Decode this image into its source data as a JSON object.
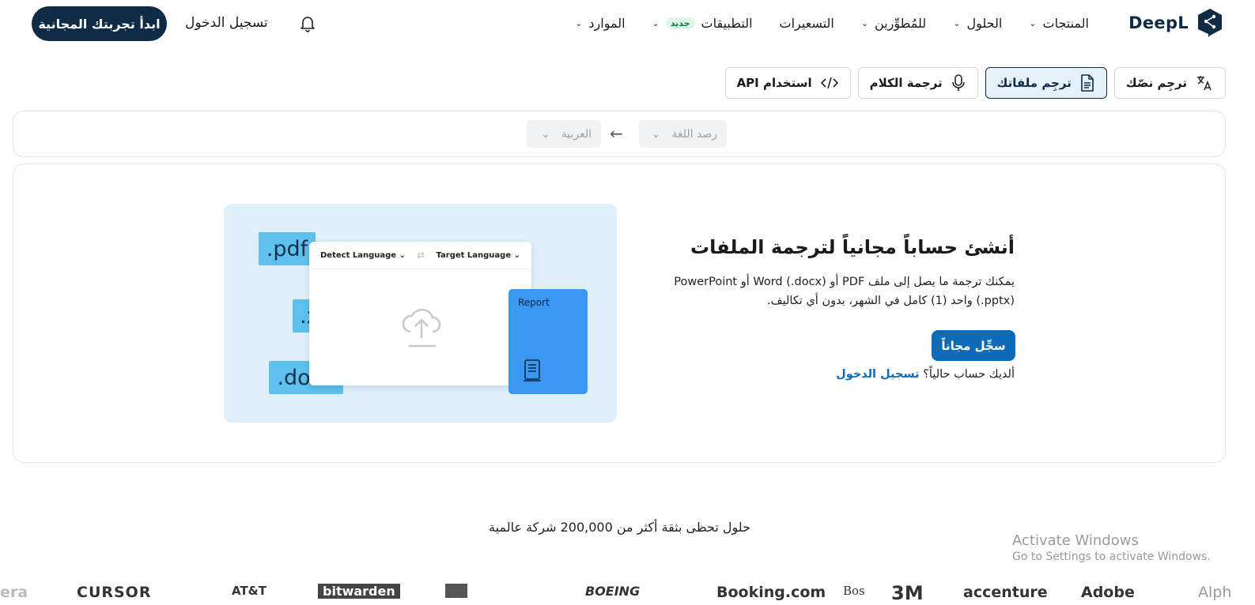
{
  "brand": {
    "name": "DeepL",
    "color": "#0f2b46"
  },
  "nav": {
    "items": [
      {
        "label": "المنتجات",
        "dropdown": true
      },
      {
        "label": "الحلول",
        "dropdown": true
      },
      {
        "label": "للمُطوِّرين",
        "dropdown": true
      },
      {
        "label": "التسعيرات",
        "dropdown": false
      },
      {
        "label": "التطبيقات",
        "badge": "جديد",
        "dropdown": true
      },
      {
        "label": "الموارد",
        "dropdown": true
      }
    ],
    "login": "تسجيل الدخول",
    "cta": "ابدأ تجربتك المجانية"
  },
  "tabs": [
    {
      "label": "ترجِم نصّك",
      "icon": "translate-icon",
      "active": false
    },
    {
      "label": "ترجِم ملفاتك",
      "icon": "file-icon",
      "active": true
    },
    {
      "label": "ترجمة الكلام",
      "icon": "microphone-icon",
      "active": false
    },
    {
      "label": "استخدام API",
      "icon": "code-icon",
      "active": false
    }
  ],
  "language_bar": {
    "source": "رصد اللغة",
    "target": "العربية"
  },
  "illustration": {
    "chips": [
      ".pdf",
      ".xlsx",
      ".docx"
    ],
    "source_lang": "Detect Language",
    "target_lang": "Target Language",
    "report_label": "Report"
  },
  "promo": {
    "heading": "أنشئ حساباً مجانياً لترجمة الملفات",
    "description": "يمكنك ترجمة ما يصل إلى ملف PDF أو Word (.docx) أو PowerPoint (.pptx) واحد (1) كامل في الشهر، بدون أي تكاليف.",
    "signup": "سجِّل مجاناً",
    "have_account": "ألديك حساب حالياً؟",
    "login_link": "تسجيل الدخول"
  },
  "trust_line": "حلول تحظى بثقة أكثر من 200,000 شركة عالمية",
  "logos": [
    "era",
    "CURSOR",
    "AT&T",
    "bitwarden",
    "",
    "BOEING",
    "Booking.com",
    "Bos",
    "3M",
    "accenture",
    "Adobe",
    "Alph"
  ],
  "watermark": {
    "line1": "Activate Windows",
    "line2": "Go to Settings to activate Windows."
  }
}
